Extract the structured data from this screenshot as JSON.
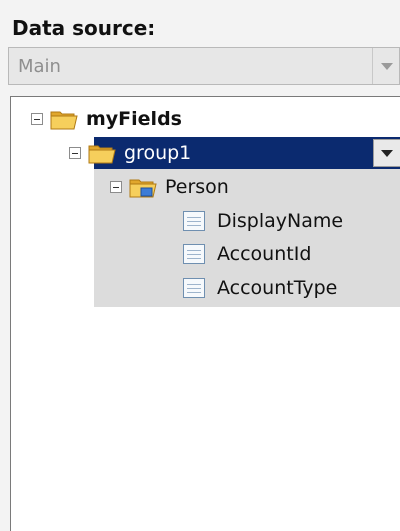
{
  "data_source": {
    "label": "Data source:",
    "selected": "Main"
  },
  "tree": {
    "root": {
      "label": "myFields",
      "expanded": true,
      "icon": "folder-open-icon"
    },
    "group": {
      "label": "group1",
      "expanded": true,
      "selected": true,
      "icon": "folder-open-icon"
    },
    "person": {
      "label": "Person",
      "expanded": true,
      "icon": "repeating-group-folder-icon"
    },
    "fields": [
      {
        "label": "DisplayName",
        "icon": "field-icon"
      },
      {
        "label": "AccountId",
        "icon": "field-icon"
      },
      {
        "label": "AccountType",
        "icon": "field-icon"
      }
    ]
  },
  "colors": {
    "selection": "#0b2a6f",
    "folder": "#f2c24b",
    "panel_bg": "#f3f3f3"
  }
}
